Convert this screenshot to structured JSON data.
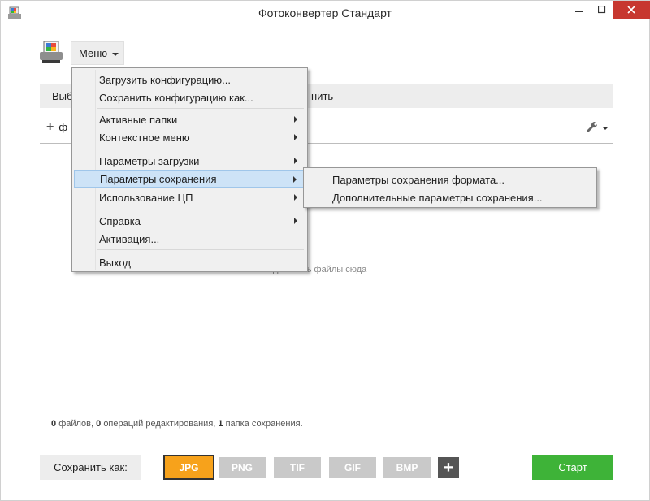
{
  "window": {
    "title": "Фотоконвертер Стандарт"
  },
  "menu_button": {
    "label": "Меню"
  },
  "toolbar": {
    "left_text": "Выб",
    "right_text": "нить",
    "add_text": "ф"
  },
  "menu": {
    "items": [
      {
        "label": "Загрузить конфигурацию..."
      },
      {
        "label": "Сохранить конфигурацию как..."
      },
      {
        "label": "Активные папки"
      },
      {
        "label": "Контекстное меню"
      },
      {
        "label": "Параметры загрузки"
      },
      {
        "label": "Параметры сохранения"
      },
      {
        "label": "Использование ЦП"
      },
      {
        "label": "Справка"
      },
      {
        "label": "Активация..."
      },
      {
        "label": "Выход"
      }
    ]
  },
  "submenu": {
    "items": [
      {
        "label": "Параметры сохранения формата..."
      },
      {
        "label": "Дополнительные параметры сохранения..."
      }
    ]
  },
  "drop_hint": "добавить файлы сюда",
  "status": {
    "files_count": "0",
    "files_label": "файлов,",
    "ops_count": "0",
    "ops_label": "операций редактирования,",
    "folders_count": "1",
    "folders_label": "папка сохранения."
  },
  "save_as_label": "Сохранить как:",
  "formats": [
    "JPG",
    "PNG",
    "TIF",
    "GIF",
    "BMP"
  ],
  "start_label": "Старт",
  "colors": {
    "accent_format": "#f7a21b",
    "start": "#3eb338",
    "highlight": "#cde3f7",
    "close": "#c7372f"
  }
}
